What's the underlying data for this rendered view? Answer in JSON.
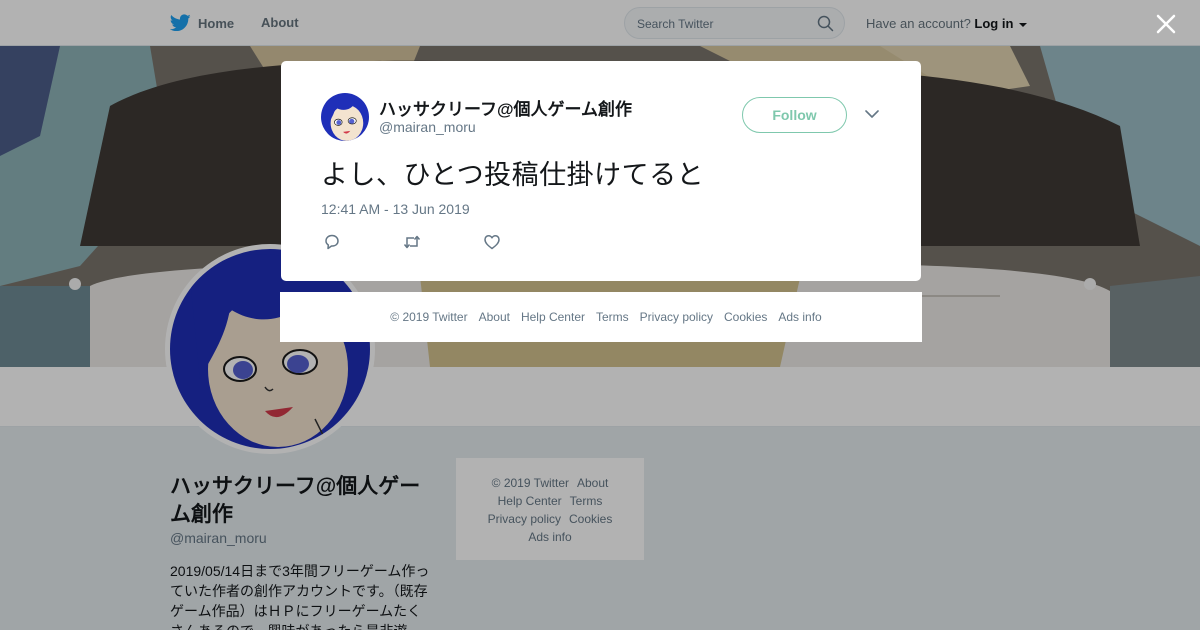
{
  "nav": {
    "home_label": "Home",
    "about_label": "About",
    "search_placeholder": "Search Twitter",
    "account_prompt": "Have an account?",
    "login_label": "Log in"
  },
  "profile": {
    "name": "ハッサクリーフ@個人ゲーム創作",
    "handle": "@mairan_moru",
    "bio": "2019/05/14日まで3年間フリーゲーム作っていた作者の創作アカウントです。（既存ゲーム作品）はＨＰにフリーゲームたくさんあるので、興味があったら是非遊"
  },
  "side_footer": {
    "links": [
      "© 2019 Twitter",
      "About",
      "Help Center",
      "Terms",
      "Privacy policy",
      "Cookies",
      "Ads info"
    ]
  },
  "tweet": {
    "author_name": "ハッサクリーフ@個人ゲーム創作",
    "author_handle": "@mairan_moru",
    "follow_label": "Follow",
    "text": "よし、ひとつ投稿仕掛けてると",
    "timestamp": "12:41 AM - 13 Jun 2019"
  },
  "modal_footer": {
    "links": [
      "© 2019 Twitter",
      "About",
      "Help Center",
      "Terms",
      "Privacy policy",
      "Cookies",
      "Ads info"
    ]
  },
  "colors": {
    "twitter_blue": "#1da1f2",
    "follow_accent": "#7fc8ad",
    "avatar_hair": "#1f2fb8",
    "avatar_skin": "#f3e3cf"
  },
  "icons": [
    "twitter-bird-icon",
    "search-icon",
    "caret-down-icon",
    "close-icon",
    "chevron-down-icon",
    "reply-icon",
    "retweet-icon",
    "like-icon"
  ]
}
